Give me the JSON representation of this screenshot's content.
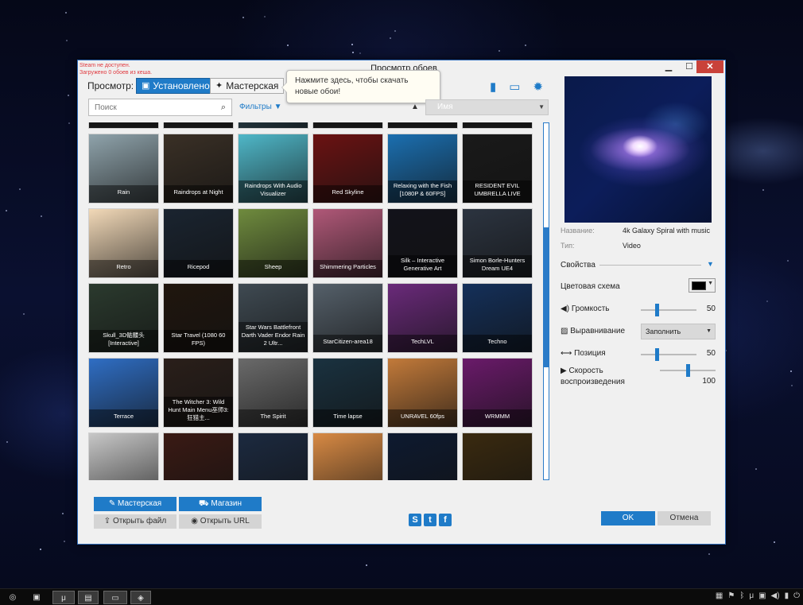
{
  "window": {
    "title": "Просмотр обоев",
    "status_line_1": "Steam не доступен.",
    "status_line_2": "Загружено 0 обоев из кеша.",
    "controls": {
      "minimize": "▁",
      "maximize": "☐",
      "close": "✕"
    }
  },
  "browse": {
    "label": "Просмотр:",
    "tabs": [
      {
        "label": "Установлено",
        "icon": "save-icon",
        "active": true
      },
      {
        "label": "Мастерская",
        "icon": "steam-icon",
        "active": false
      }
    ]
  },
  "tooltip": {
    "text": "Нажмите здесь, чтобы скачать новые обои!"
  },
  "toolbar_icons": [
    "file-icon",
    "monitor-icon",
    "gear-icon"
  ],
  "search": {
    "placeholder": "Поиск",
    "value": ""
  },
  "filters": {
    "label": "Фильтры"
  },
  "sort": {
    "direction": "▲",
    "value": "Имя"
  },
  "wallpapers": [
    {
      "title": "",
      "row": 0
    },
    {
      "title": "",
      "row": 0
    },
    {
      "title": "Rain",
      "row": 0
    },
    {
      "title": "",
      "row": 0
    },
    {
      "title": "",
      "row": 0
    },
    {
      "title": "",
      "row": 0
    },
    {
      "title": "Rain",
      "row": 1
    },
    {
      "title": "Raindrops at Night",
      "row": 1
    },
    {
      "title": "Raindrops With Audio Visualizer",
      "row": 1
    },
    {
      "title": "Red Skyline",
      "row": 1
    },
    {
      "title": "Relaxing with the Fish [1080P & 60FPS]",
      "row": 1
    },
    {
      "title": "RESIDENT EVIL UMBRELLA LIVE",
      "row": 1
    },
    {
      "title": "Retro",
      "row": 2
    },
    {
      "title": "Ricepod",
      "row": 2
    },
    {
      "title": "Sheep",
      "row": 2
    },
    {
      "title": "Shimmering Particles",
      "row": 2
    },
    {
      "title": "Silk – Interactive Generative Art",
      "row": 2
    },
    {
      "title": "Simon Borle-Hunters Dream UE4",
      "row": 2
    },
    {
      "title": "Skull_3D骷髅头 [Interactive]",
      "row": 3
    },
    {
      "title": "Star Travel (1080 60 FPS)",
      "row": 3
    },
    {
      "title": "Star Wars Battlefront Darth Vader Endor Rain 2 Ultr...",
      "row": 3
    },
    {
      "title": "StarCitizen-area18",
      "row": 3
    },
    {
      "title": "TechLVL",
      "row": 3
    },
    {
      "title": "Techno",
      "row": 3
    },
    {
      "title": "Terrace",
      "row": 4
    },
    {
      "title": "The Witcher 3: Wild Hunt Main Menu巫师3:狂猎主...",
      "row": 4
    },
    {
      "title": "The Spirit",
      "row": 4
    },
    {
      "title": "Time lapse",
      "row": 4
    },
    {
      "title": "UNRAVEL 60fps",
      "row": 4
    },
    {
      "title": "WRMMM",
      "row": 4
    },
    {
      "title": "",
      "row": 5
    },
    {
      "title": "",
      "row": 5
    },
    {
      "title": "",
      "row": 5
    },
    {
      "title": "",
      "row": 5
    },
    {
      "title": "",
      "row": 5
    },
    {
      "title": "",
      "row": 5
    }
  ],
  "thumb_colors": [
    "#1c1c1c",
    "#1c1c1c",
    "#6aa4c0",
    "#1c1c1c",
    "#1c1c1c",
    "#1c1c1c",
    "#8fa3ab",
    "#3a3026",
    "#4fb7c8",
    "#6b1212",
    "#1b6fb0",
    "#1a1a1a",
    "#f2d9b8",
    "#1a2430",
    "#6f8b3e",
    "#b05878",
    "#12121a",
    "#2c3440",
    "#2b3a2e",
    "#20160e",
    "#3f4a52",
    "#55606a",
    "#6a2a7a",
    "#14305a",
    "#2f6ec4",
    "#2a1f1a",
    "#6a6a6a",
    "#1a3240",
    "#c27a3a",
    "#6a1a6a",
    "#c7c7c7",
    "#3a1a14",
    "#1c2a40",
    "#d88a44",
    "#0e1a30",
    "#3a2a10"
  ],
  "scroll": {
    "position": 0.48
  },
  "bottom_buttons": {
    "workshop": "Мастерская",
    "shop": "Магазин",
    "open_file": "Открыть файл",
    "open_url": "Открыть URL"
  },
  "social": [
    "steam-icon",
    "twitter-icon",
    "facebook-icon"
  ],
  "details": {
    "name_key": "Название:",
    "name_value": "4k Galaxy Spiral with music",
    "type_key": "Тип:",
    "type_value": "Video"
  },
  "properties": {
    "section_label": "Свойства",
    "color_scheme_label": "Цветовая схема",
    "color_scheme_value": "#000000",
    "volume_label": "Громкость",
    "volume_value": "50",
    "alignment_label": "Выравнивание",
    "alignment_value": "Заполнить",
    "position_label": "Позиция",
    "position_value": "50",
    "speed_label_1": "Скорость",
    "speed_label_2": "воспроизведения",
    "speed_value": "100"
  },
  "dialog": {
    "ok": "OK",
    "cancel": "Отмена"
  },
  "taskbar": {
    "items": [
      "chrome-icon",
      "app-icon",
      "utorrent-icon",
      "explorer-icon",
      "wallpaper-engine-icon",
      "nvidia-icon"
    ],
    "tray": [
      "network-icon",
      "flag-icon",
      "bluetooth-icon",
      "utorrent-tray-icon",
      "app-tray-icon",
      "volume-icon",
      "battery-icon",
      "power-icon"
    ]
  }
}
